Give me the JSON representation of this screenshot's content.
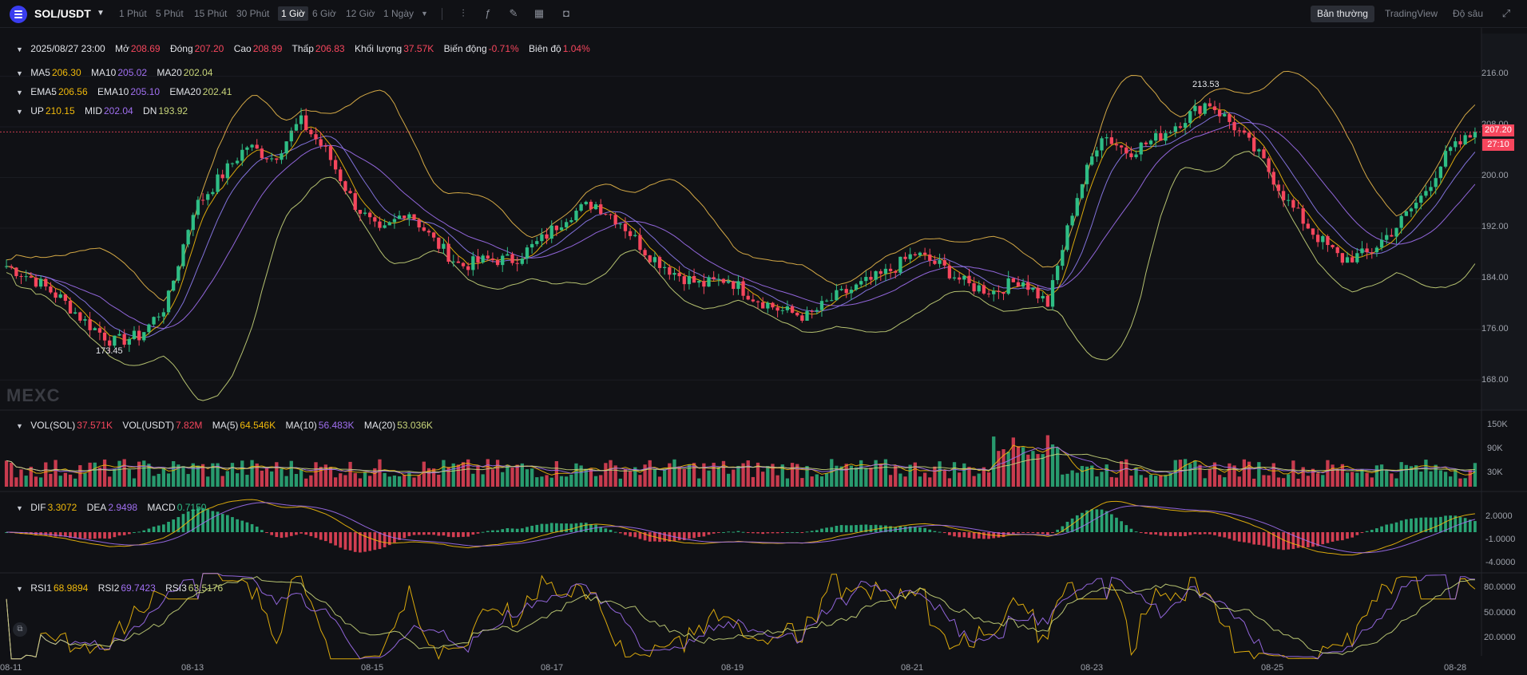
{
  "toolbar": {
    "symbol": "SOL/USDT",
    "timeframes": [
      "1 Phút",
      "5 Phút",
      "15 Phút",
      "30 Phút",
      "1 Giờ",
      "6 Giờ",
      "12 Giờ",
      "1 Ngày"
    ],
    "active_timeframe": "1 Giờ",
    "modes": [
      "Bản thường",
      "TradingView",
      "Độ sâu"
    ],
    "active_mode": "Bản thường",
    "icons": [
      "candle-type-icon",
      "indicator-icon",
      "draw-icon",
      "layout-grid-icon",
      "camera-icon",
      "fullscreen-icon"
    ]
  },
  "ohlc": {
    "date": "2025/08/27 23:00",
    "open_label": "Mở",
    "open": "208.69",
    "close_label": "Đóng",
    "close": "207.20",
    "high_label": "Cao",
    "high": "208.99",
    "low_label": "Thấp",
    "low": "206.83",
    "volume_label": "Khối lượng",
    "volume": "37.57K",
    "change_label": "Biến động",
    "change": "-0.71%",
    "amplitude_label": "Biên độ",
    "amplitude": "1.04%"
  },
  "ma_legend": {
    "ma5_label": "MA5",
    "ma5": "206.30",
    "ma10_label": "MA10",
    "ma10": "205.02",
    "ma20_label": "MA20",
    "ma20": "202.04"
  },
  "ema_legend": {
    "ema5_label": "EMA5",
    "ema5": "206.56",
    "ema10_label": "EMA10",
    "ema10": "205.10",
    "ema20_label": "EMA20",
    "ema20": "202.41"
  },
  "boll_legend": {
    "up_label": "UP",
    "up": "210.15",
    "mid_label": "MID",
    "mid": "202.04",
    "dn_label": "DN",
    "dn": "193.92"
  },
  "vol_legend": {
    "sol_label": "VOL(SOL)",
    "sol": "37.571K",
    "usdt_label": "VOL(USDT)",
    "usdt": "7.82M",
    "ma5_label": "MA(5)",
    "ma5": "64.546K",
    "ma10_label": "MA(10)",
    "ma10": "56.483K",
    "ma20_label": "MA(20)",
    "ma20": "53.036K"
  },
  "macd_legend": {
    "dif_label": "DIF",
    "dif": "3.3072",
    "dea_label": "DEA",
    "dea": "2.9498",
    "macd_label": "MACD",
    "macd": "0.7150"
  },
  "rsi_legend": {
    "rsi1_label": "RSI1",
    "rsi1": "68.9894",
    "rsi2_label": "RSI2",
    "rsi2": "69.7423",
    "rsi3_label": "RSI3",
    "rsi3": "63.5176"
  },
  "price_axis": [
    "216.00",
    "208.00",
    "200.00",
    "192.00",
    "184.00",
    "176.00",
    "168.00"
  ],
  "vol_axis": [
    "150K",
    "90K",
    "30K"
  ],
  "macd_axis": [
    "2.0000",
    "-1.0000",
    "-4.0000"
  ],
  "rsi_axis": [
    "80.0000",
    "50.0000",
    "20.0000"
  ],
  "last_price": "207.20",
  "countdown": "27:10",
  "annotations": {
    "high": "213.53",
    "low": "173.45"
  },
  "watermark": "MEXC",
  "x_labels": [
    "08-11",
    "08-13",
    "08-15",
    "08-17",
    "08-19",
    "08-21",
    "08-23",
    "08-25",
    "08-28"
  ],
  "colors": {
    "up": "#2ebd85",
    "down": "#f6465d",
    "ma5": "#f0b90b",
    "ma10": "#a06ff0",
    "ma20": "#c8d57a",
    "boll": "#e8b84a"
  },
  "chart_data": {
    "type": "candlestick",
    "title": "SOL/USDT",
    "x": [
      "08-11",
      "08-13",
      "08-15",
      "08-17",
      "08-19",
      "08-21",
      "08-23",
      "08-25",
      "08-28"
    ],
    "ylim": [
      164,
      222
    ],
    "price_path": [
      186,
      184,
      181,
      177,
      174,
      175,
      180,
      195,
      200,
      205,
      203,
      209,
      204,
      196,
      191,
      195,
      190,
      186,
      187,
      187,
      190,
      194,
      196,
      193,
      188,
      185,
      183,
      184,
      181,
      179,
      178,
      181,
      183,
      185,
      188,
      186,
      183,
      182,
      184,
      180,
      196,
      207,
      204,
      206,
      209,
      212,
      208,
      203,
      196,
      191,
      187,
      188,
      192,
      197,
      204,
      207
    ],
    "last_price": 207.2,
    "high_annotation": 213.53,
    "low_annotation": 173.45
  }
}
